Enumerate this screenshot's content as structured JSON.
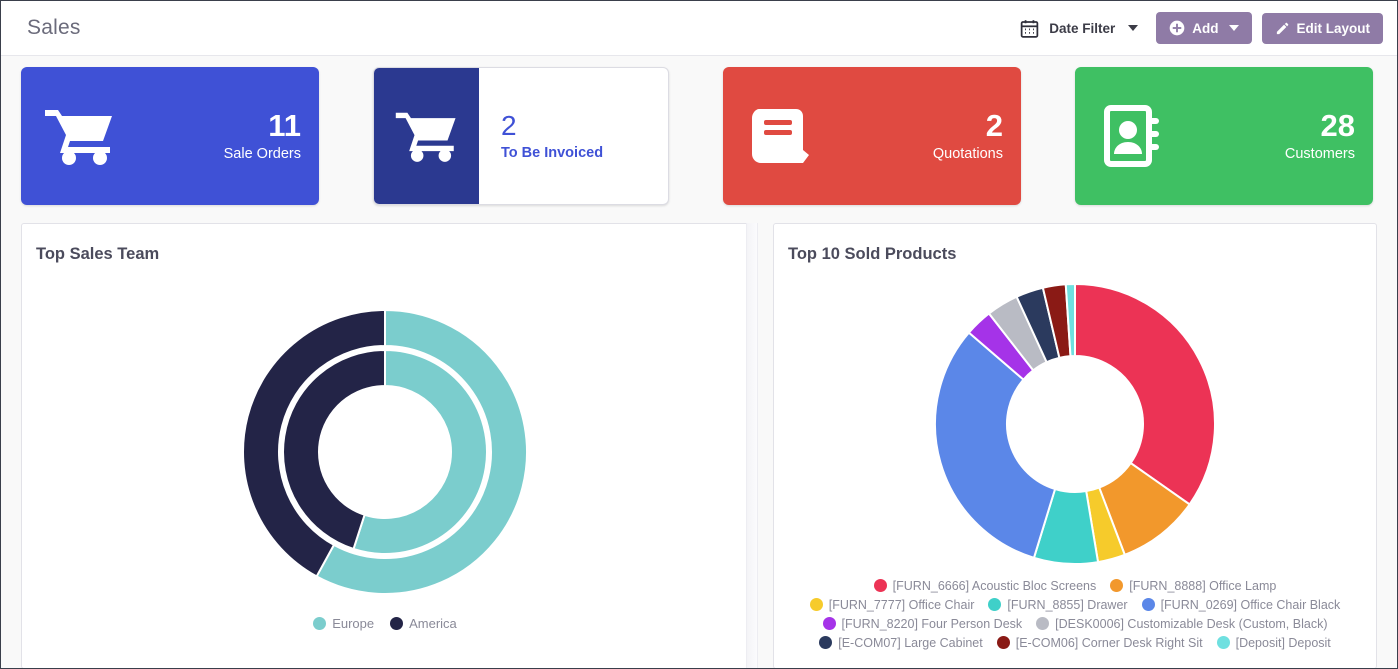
{
  "header": {
    "title": "Sales",
    "date_filter": {
      "label": "Date Filter",
      "icon": "calendar-icon"
    },
    "add_button": {
      "label": "Add",
      "icon": "plus-circle-icon"
    },
    "edit_layout_button": {
      "label": "Edit Layout",
      "icon": "pencil-icon"
    },
    "accent_purple": "#8f7ba6"
  },
  "kpis": [
    {
      "value": "11",
      "caption": "Sale Orders",
      "icon": "shopping-cart-icon",
      "color": "#3f51d6",
      "style": "solid"
    },
    {
      "value": "2",
      "caption": "To Be Invoiced",
      "icon": "shopping-cart-icon",
      "color": "#2b3990",
      "style": "split"
    },
    {
      "value": "2",
      "caption": "Quotations",
      "icon": "book-icon",
      "color": "#e04a41",
      "style": "solid"
    },
    {
      "value": "28",
      "caption": "Customers",
      "icon": "address-book-icon",
      "color": "#3fc063",
      "style": "solid"
    }
  ],
  "panels": {
    "left_title": "Top Sales Team",
    "right_title": "Top 10 Sold Products"
  },
  "chart_data": [
    {
      "type": "pie",
      "title": "Top Sales Team",
      "subtitle": "",
      "variant": "doughnut-multiring",
      "legend_position": "bottom",
      "rings": [
        {
          "name": "outer",
          "values": [
            58,
            42
          ]
        },
        {
          "name": "inner",
          "values": [
            55,
            45
          ]
        }
      ],
      "categories": [
        "Europe",
        "America"
      ],
      "values": [
        58,
        42
      ],
      "colors": [
        "#7bcdcd",
        "#232447"
      ],
      "xlabel": "",
      "ylabel": ""
    },
    {
      "type": "pie",
      "title": "Top 10 Sold Products",
      "subtitle": "",
      "variant": "doughnut",
      "legend_position": "bottom",
      "categories": [
        "[FURN_6666] Acoustic Bloc Screens",
        "[FURN_8888] Office Lamp",
        "[FURN_7777] Office Chair",
        "[FURN_8855] Drawer",
        "[FURN_0269] Office Chair Black",
        "[FURN_8220] Four Person Desk",
        "[DESK0006] Customizable Desk (Custom, Black)",
        "[E-COM07] Large Cabinet",
        "[E-COM06] Corner Desk Right Sit",
        "[Deposit] Deposit"
      ],
      "values": [
        33.0,
        9.0,
        3.0,
        7.0,
        30.0,
        3.0,
        3.5,
        3.0,
        2.5,
        1.0
      ],
      "colors": [
        "#ec3355",
        "#f2982c",
        "#f6cb2b",
        "#3fd0c9",
        "#5b87e8",
        "#a533e8",
        "#b9bbc4",
        "#2b3a5e",
        "#8a1a15",
        "#6fe0e0"
      ],
      "xlabel": "",
      "ylabel": ""
    }
  ]
}
